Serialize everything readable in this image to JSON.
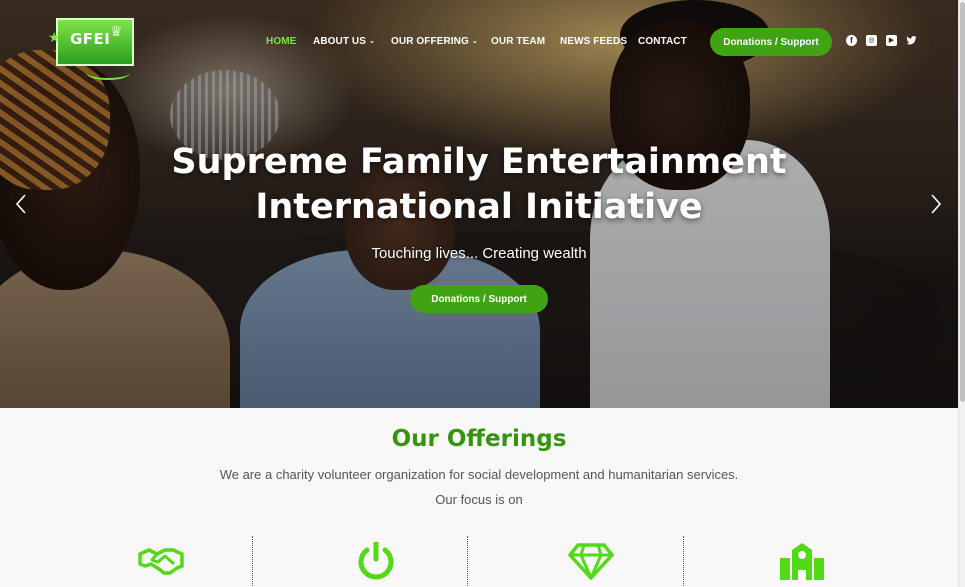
{
  "header": {
    "logo_text": "GFEI",
    "nav": [
      {
        "label": "HOME",
        "active": true,
        "has_dropdown": false
      },
      {
        "label": "ABOUT US",
        "active": false,
        "has_dropdown": true
      },
      {
        "label": "OUR OFFERING",
        "active": false,
        "has_dropdown": true
      },
      {
        "label": "OUR TEAM",
        "active": false,
        "has_dropdown": false
      },
      {
        "label": "NEWS FEEDS",
        "active": false,
        "has_dropdown": false
      },
      {
        "label": "CONTACT",
        "active": false,
        "has_dropdown": false
      }
    ],
    "cta_label": "Donations / Support",
    "social_icons": [
      "facebook-icon",
      "instagram-icon",
      "youtube-icon",
      "twitter-icon"
    ]
  },
  "hero": {
    "title_line1": "Supreme Family Entertainment",
    "title_line2": "International Initiative",
    "subtitle": "Touching lives... Creating wealth",
    "cta_label": "Donations / Support",
    "prev_icon": "chevron-left-icon",
    "next_icon": "chevron-right-icon"
  },
  "offerings": {
    "title": "Our Offerings",
    "description": "We are a charity volunteer organization for social development and humanitarian services.",
    "focus": "Our focus is on",
    "items": [
      {
        "icon": "handshake-icon",
        "label": ""
      },
      {
        "icon": "power-icon",
        "label": ""
      },
      {
        "icon": "diamond-icon",
        "label": ""
      },
      {
        "icon": "building-icon",
        "label": ""
      }
    ]
  },
  "colors": {
    "accent_green": "#3fa314",
    "nav_active": "#7ee34a",
    "offerings_title": "#35940f",
    "icon_green": "#52d917"
  }
}
